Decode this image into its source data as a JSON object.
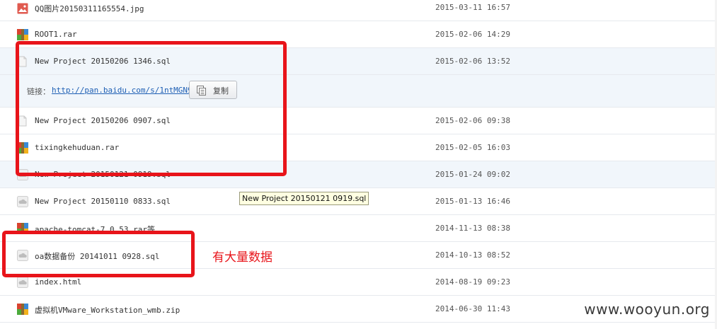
{
  "files": [
    {
      "name": "QQ图片20150311165554.jpg",
      "date": "2015-03-11 16:57",
      "icon": "image-file-icon"
    },
    {
      "name": "ROOT1.rar",
      "date": "2015-02-06 14:29",
      "icon": "archive-file-icon"
    },
    {
      "name": "New Project 20150206 1346.sql",
      "date": "2015-02-06 13:52",
      "icon": "document-file-icon"
    },
    {
      "name": "New Project 20150206 0907.sql",
      "date": "2015-02-06 09:38",
      "icon": "document-file-icon"
    },
    {
      "name": "tixingkehuduan.rar",
      "date": "2015-02-05 16:03",
      "icon": "archive-file-icon"
    },
    {
      "name": "New Project 20150121 0919.sql",
      "date": "2015-01-24 09:02",
      "icon": "cloud-file-icon"
    },
    {
      "name": "New Project 20150110 0833.sql",
      "date": "2015-01-13 16:46",
      "icon": "cloud-file-icon"
    },
    {
      "name": "apache-tomcat-7.0.53.rar等",
      "date": "2014-11-13 08:38",
      "icon": "archive-file-icon"
    },
    {
      "name": "oa数据备份 20141011 0928.sql",
      "date": "2014-10-13 08:52",
      "icon": "cloud-file-icon"
    },
    {
      "name": "index.html",
      "date": "2014-08-19 09:23",
      "icon": "cloud-file-icon"
    },
    {
      "name": "虚拟机VMware_Workstation_wmb.zip",
      "date": "2014-06-30 11:43",
      "icon": "archive-file-icon"
    }
  ],
  "share_link": {
    "label": "链接：",
    "url": "http://pan.baidu.com/s/1ntMGN9J",
    "copy_label": "复制"
  },
  "tooltip": "New Project 20150121 0919.sql",
  "annotation": "有大量数据",
  "watermark": "www.wooyun.org",
  "colors": {
    "highlight": "#f1f6fb",
    "annotation_red": "#e8141a",
    "link": "#1e5fb4"
  }
}
